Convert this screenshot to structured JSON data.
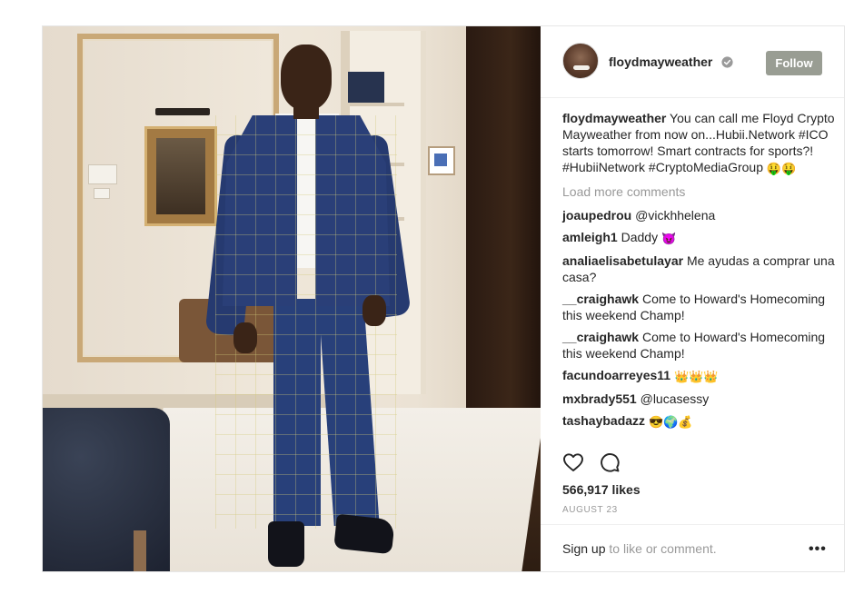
{
  "post": {
    "username": "floydmayweather",
    "follow_label": "Follow",
    "caption_user": "floydmayweather",
    "caption_text": "You can call me Floyd Crypto Mayweather from now on...Hubii.Network #ICO starts tomorrow! Smart contracts for sports?! #HubiiNetwork #CryptoMediaGroup",
    "caption_emoji": "🤑🤑",
    "load_more": "Load more comments",
    "comments": [
      {
        "user": "joaupedrou",
        "text": "@vickhhelena",
        "emoji": ""
      },
      {
        "user": "amleigh1",
        "text": "Daddy",
        "emoji": "😈"
      },
      {
        "user": "analiaelisabetulayar",
        "text": "Me ayudas a comprar una casa?",
        "emoji": ""
      },
      {
        "user": "__craighawk",
        "text": "Come to Howard's Homecoming this weekend Champ!",
        "emoji": ""
      },
      {
        "user": "__craighawk",
        "text": "Come to Howard's Homecoming this weekend Champ!",
        "emoji": ""
      },
      {
        "user": "facundoarreyes11",
        "text": "",
        "emoji": "👑👑👑"
      },
      {
        "user": "mxbrady551",
        "text": "@lucasessy",
        "emoji": ""
      },
      {
        "user": "tashaybadazz",
        "text": "",
        "emoji": "😎🌍💰"
      }
    ],
    "likes": "566,917 likes",
    "date": "AUGUST 23",
    "signup_prefix": "Sign up",
    "signup_suffix": "to like or comment.",
    "more_label": "•••"
  },
  "icons": {
    "verified": "verified-badge-icon",
    "like": "heart-icon",
    "comment": "comment-bubble-icon",
    "more": "more-options-icon"
  },
  "colors": {
    "follow_bg": "#999d93",
    "muted_text": "#999999",
    "text": "#262626"
  }
}
